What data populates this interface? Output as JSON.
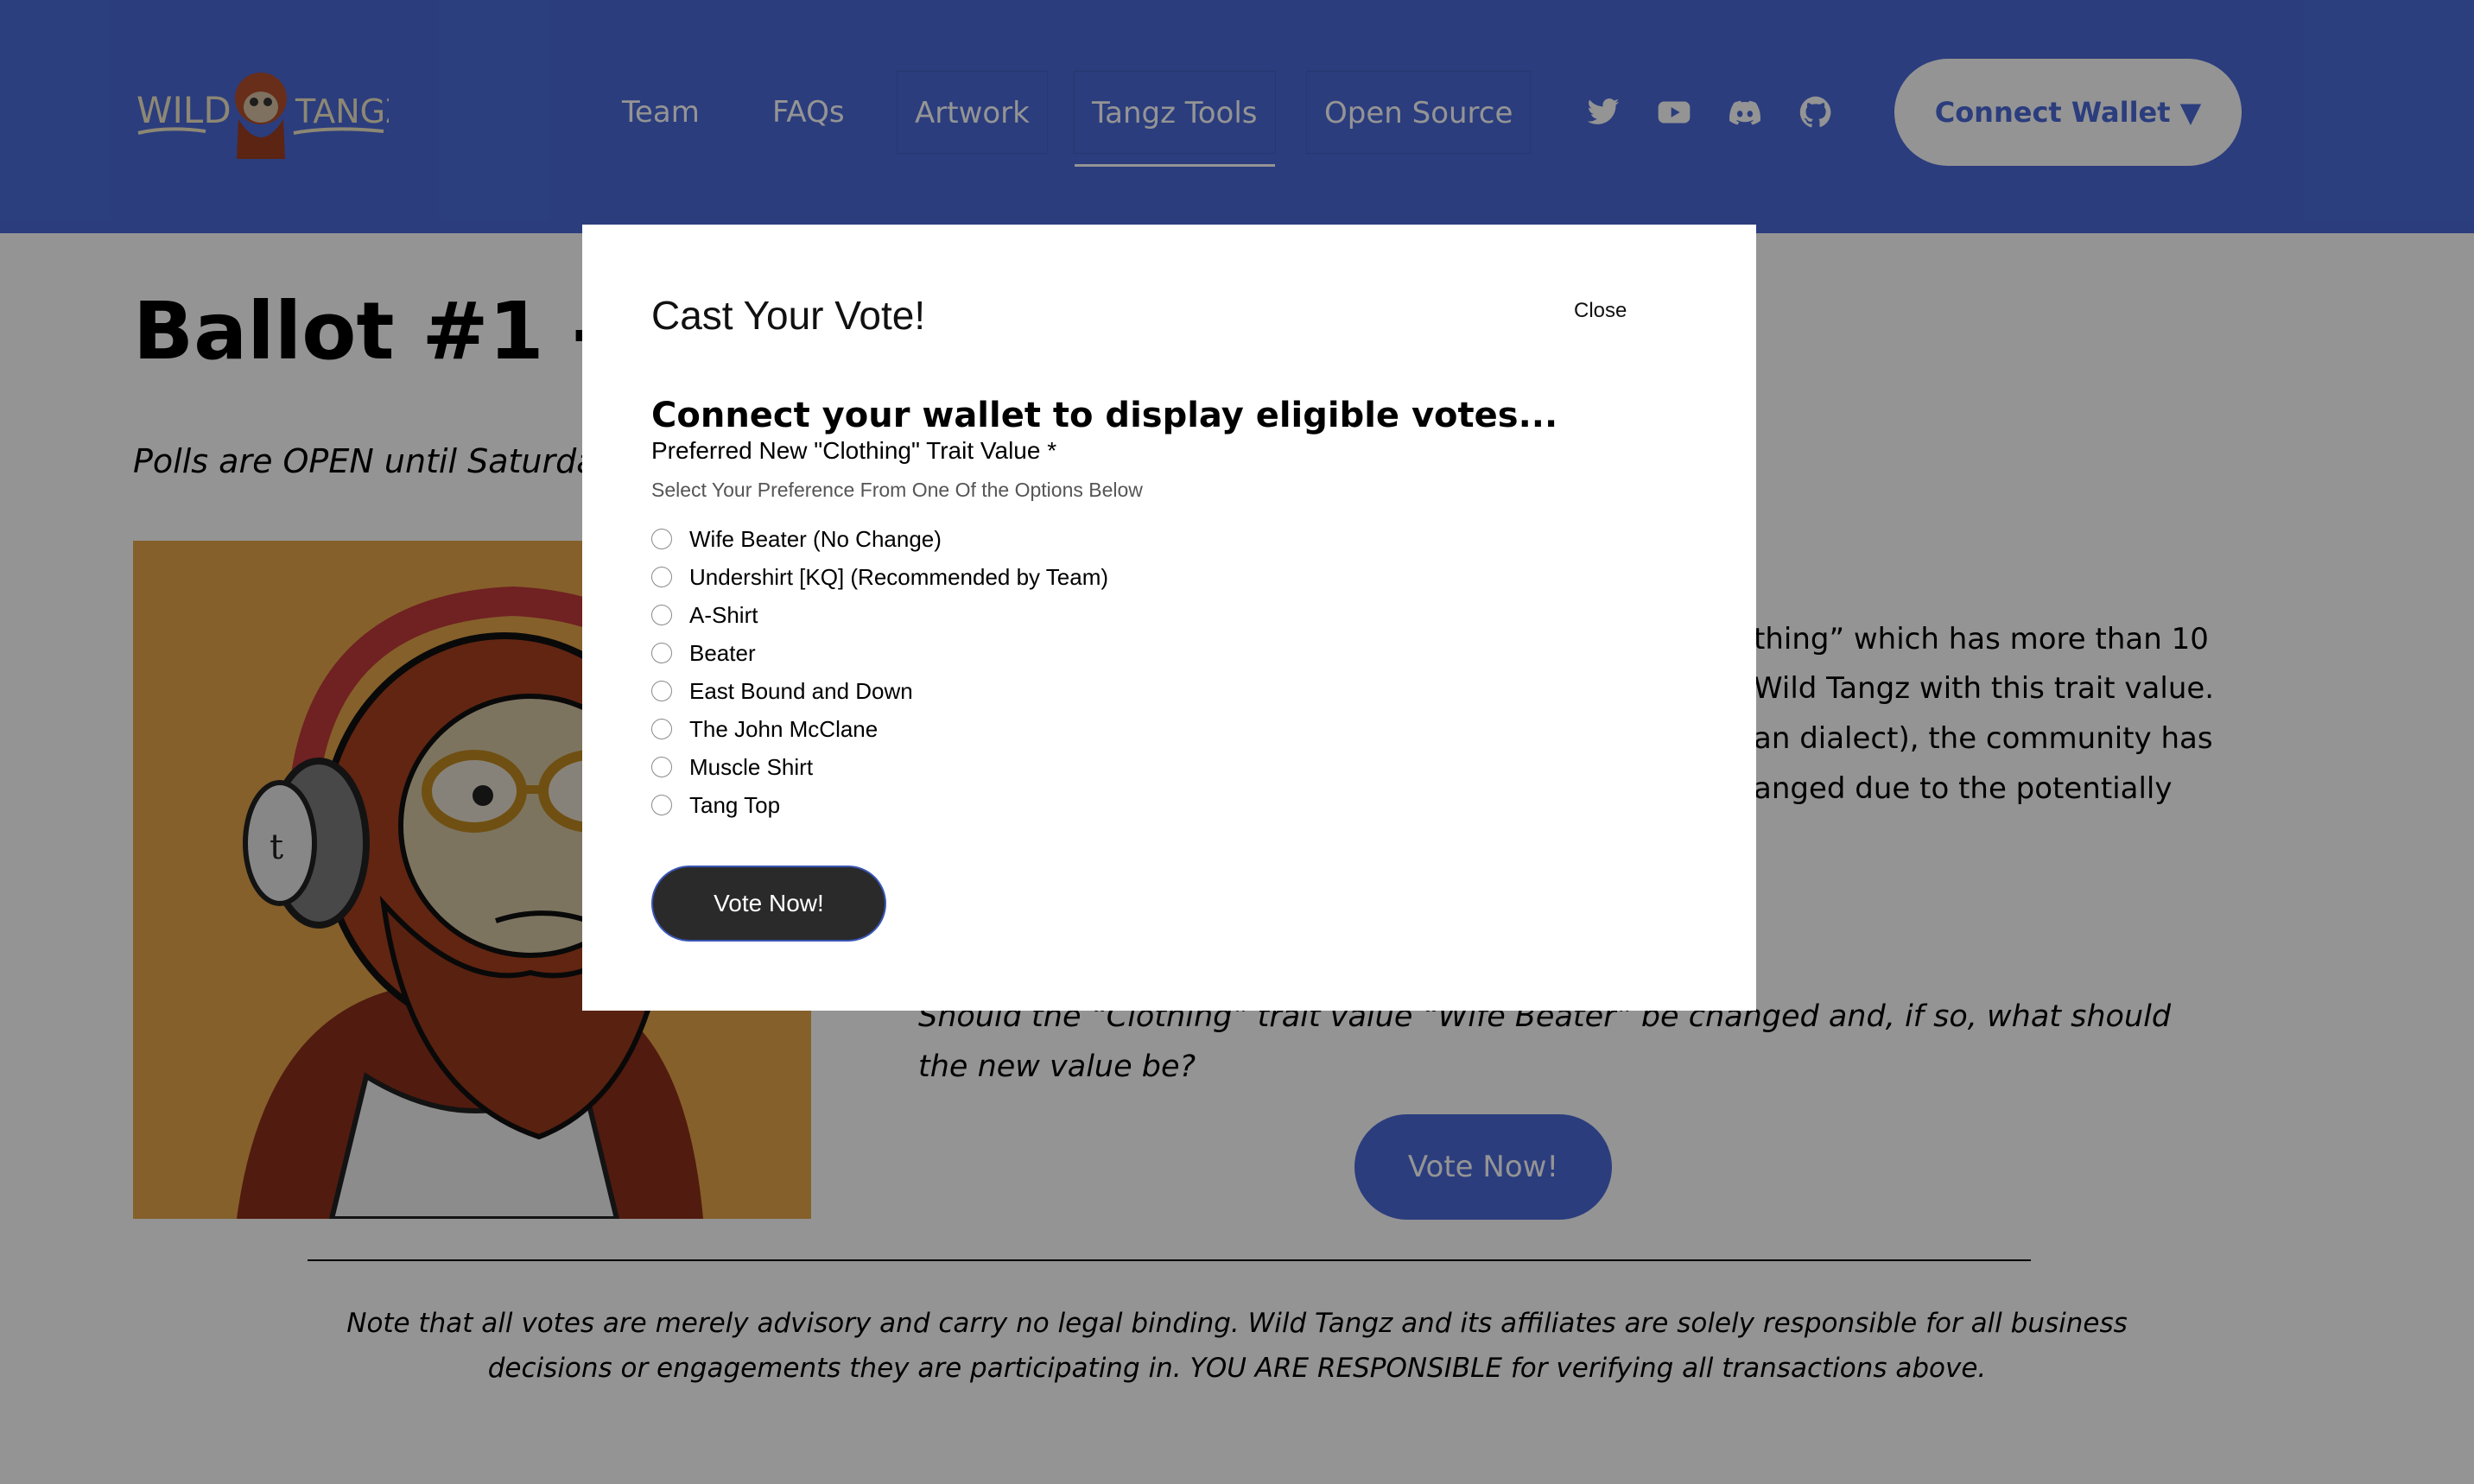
{
  "header": {
    "logo": {
      "left_text": "WILD",
      "right_text": "TANGZ"
    },
    "nav": [
      {
        "label": "Team"
      },
      {
        "label": "FAQs"
      },
      {
        "label": "Artwork"
      },
      {
        "label": "Tangz Tools"
      },
      {
        "label": "Open Source"
      }
    ],
    "social_icons": [
      "twitter-icon",
      "youtube-icon",
      "discord-icon",
      "github-icon"
    ],
    "connect_wallet": "Connect Wallet ▼"
  },
  "page": {
    "title": "Ballot #1 - ‘W",
    "polls": "Polls are OPEN until Saturda",
    "description_lines": [
      "thing” which has more than 10",
      "Wild Tangz with this trait value.",
      "an dialect), the community has",
      "anged due to the potentially"
    ],
    "question": "Should the “Clothing” trait value “Wife Beater” be changed and, if so, what should the new value be?",
    "vote_button": "Vote Now!",
    "note_line1": "Note that all votes are merely advisory and carry no legal binding.  Wild Tangz and its affiliates are solely responsible for all business",
    "note_line2": "decisions or engagements they are participating in.  YOU ARE RESPONSIBLE for verifying all transactions above."
  },
  "modal": {
    "title": "Cast Your Vote!",
    "close": "Close",
    "connect_prompt": "Connect your wallet to display eligible votes...",
    "field_label": "Preferred New \"Clothing\" Trait Value *",
    "field_help": "Select Your Preference From One Of the Options Below",
    "options": [
      "Wife Beater (No Change)",
      "Undershirt [KQ] (Recommended by Team)",
      "A-Shirt",
      "Beater",
      "East Bound and Down",
      "The John McClane",
      "Muscle Shirt",
      "Tang Top"
    ],
    "vote_button": "Vote Now!"
  },
  "colors": {
    "brand_blue": "#4a6ad8",
    "art_orange": "#e6a54a",
    "modal_button": "#2a2a2a"
  }
}
